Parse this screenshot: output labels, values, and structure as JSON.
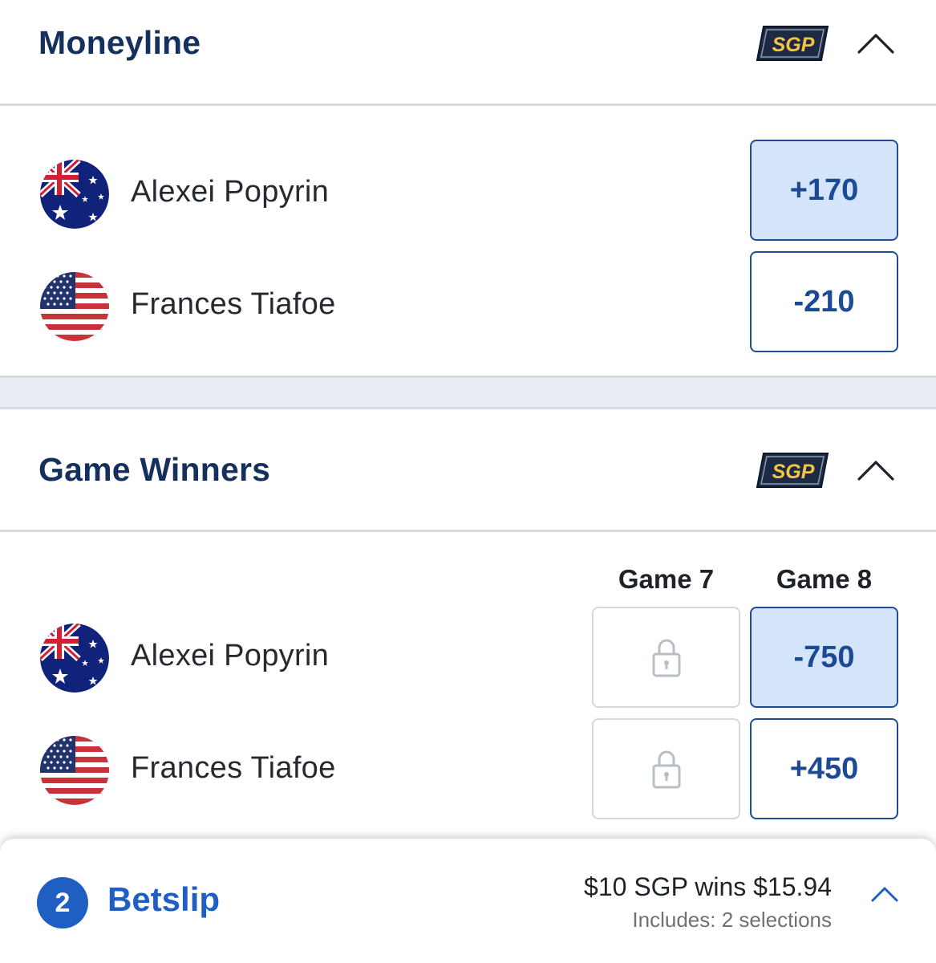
{
  "moneyline": {
    "title": "Moneyline",
    "badge": "SGP",
    "rows": [
      {
        "player": "Alexei Popyrin",
        "flag": "australia-flag-icon",
        "odds": "+170",
        "selected": true
      },
      {
        "player": "Frances Tiafoe",
        "flag": "usa-flag-icon",
        "odds": "-210",
        "selected": false
      }
    ]
  },
  "game_winners": {
    "title": "Game Winners",
    "badge": "SGP",
    "columns": [
      "Game 7",
      "Game 8"
    ],
    "rows": [
      {
        "player": "Alexei Popyrin",
        "flag": "australia-flag-icon",
        "game7": "locked",
        "game8": "-750",
        "selected": true
      },
      {
        "player": "Frances Tiafoe",
        "flag": "usa-flag-icon",
        "game7": "locked",
        "game8": "+450",
        "selected": false
      }
    ]
  },
  "betslip": {
    "count": "2",
    "label": "Betslip",
    "wins_text": "$10 SGP wins $15.94",
    "includes_text": "Includes: 2 selections"
  },
  "colors": {
    "navy_title": "#15305c",
    "odds_blue": "#1d4a95",
    "selected_fill": "#d3e4fb",
    "sgp_gold": "#f6c443",
    "betslip_blue": "#1f5fc4"
  }
}
